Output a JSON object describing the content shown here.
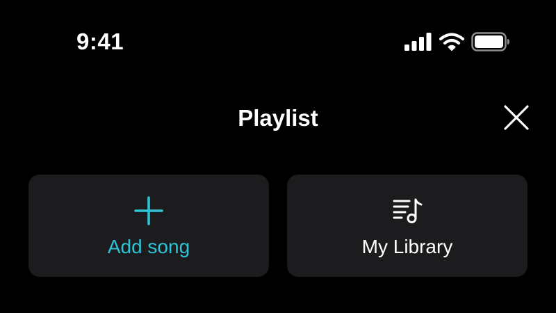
{
  "status_bar": {
    "time": "9:41",
    "icons": [
      "cellular-signal-icon",
      "wifi-icon",
      "battery-icon"
    ]
  },
  "header": {
    "title": "Playlist",
    "close_icon": "close-icon"
  },
  "actions": {
    "add_song": {
      "label": "Add song",
      "icon": "plus-icon",
      "color": "#2ec4d6"
    },
    "my_library": {
      "label": "My Library",
      "icon": "music-list-icon",
      "color": "#ffffff"
    }
  },
  "colors": {
    "background": "#000000",
    "card_background": "#1c1c1e",
    "accent": "#2ec4d6",
    "text": "#ffffff"
  }
}
